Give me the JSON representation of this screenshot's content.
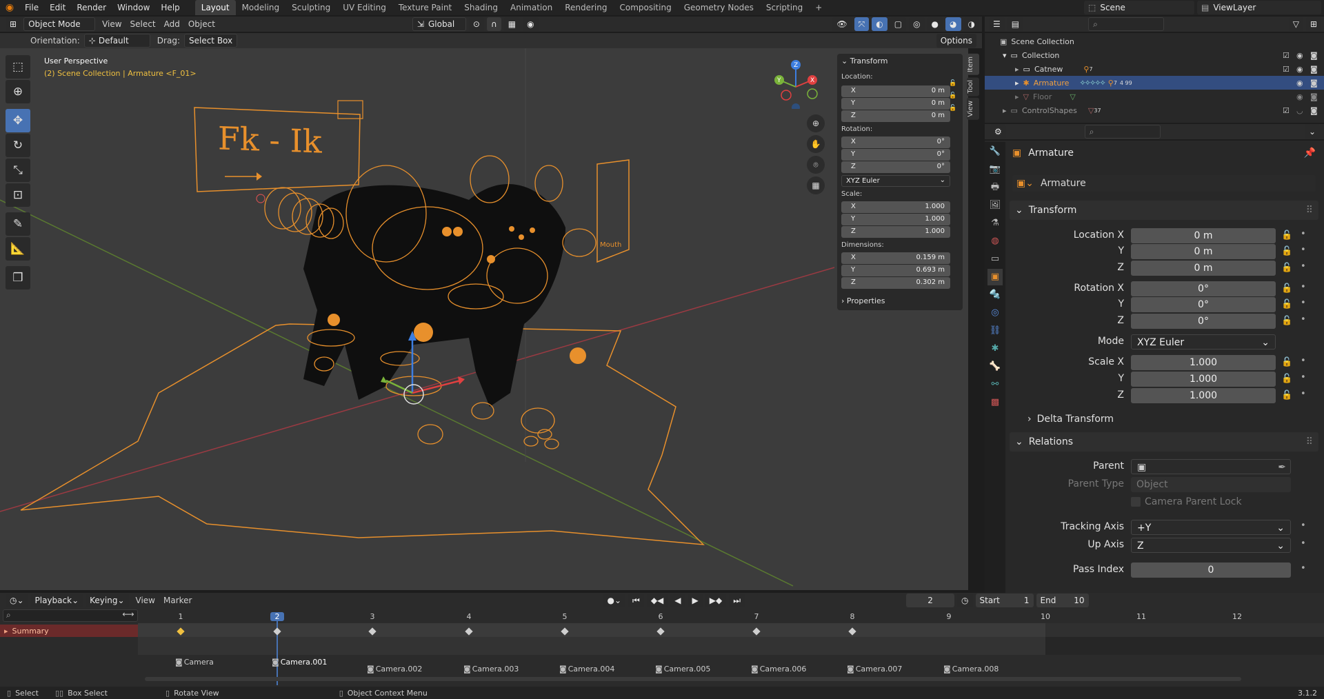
{
  "menu": {
    "items": [
      "File",
      "Edit",
      "Render",
      "Window",
      "Help"
    ]
  },
  "workspaces": [
    "Layout",
    "Modeling",
    "Sculpting",
    "UV Editing",
    "Texture Paint",
    "Shading",
    "Animation",
    "Rendering",
    "Compositing",
    "Geometry Nodes",
    "Scripting"
  ],
  "top_right": {
    "scene_label": "Scene",
    "view_layer_label": "ViewLayer",
    "plus": "+"
  },
  "viewport_header": {
    "mode": "Object Mode",
    "view": "View",
    "select": "Select",
    "add": "Add",
    "object": "Object",
    "transform_orientation": "Global",
    "orientation_label": "Orientation:",
    "orientation_value": "Default",
    "drag_label": "Drag:",
    "drag_value": "Select Box",
    "options": "Options"
  },
  "viewport": {
    "perspective": "User Perspective",
    "collection_path": "(2) Scene Collection | Armature <F_01>",
    "sign_text": "Fk  -  Ik",
    "mouth_label": "Mouth",
    "gizmo": {
      "x": "X",
      "y": "Y",
      "z": "Z"
    }
  },
  "npanel": {
    "title": "Transform",
    "location_label": "Location:",
    "location": [
      {
        "axis": "X",
        "value": "0 m"
      },
      {
        "axis": "Y",
        "value": "0 m"
      },
      {
        "axis": "Z",
        "value": "0 m"
      }
    ],
    "rotation_label": "Rotation:",
    "rotation": [
      {
        "axis": "X",
        "value": "0°"
      },
      {
        "axis": "Y",
        "value": "0°"
      },
      {
        "axis": "Z",
        "value": "0°"
      }
    ],
    "rotation_mode": "XYZ Euler",
    "scale_label": "Scale:",
    "scale": [
      {
        "axis": "X",
        "value": "1.000"
      },
      {
        "axis": "Y",
        "value": "1.000"
      },
      {
        "axis": "Z",
        "value": "1.000"
      }
    ],
    "dimensions_label": "Dimensions:",
    "dimensions": [
      {
        "axis": "X",
        "value": "0.159 m"
      },
      {
        "axis": "Y",
        "value": "0.693 m"
      },
      {
        "axis": "Z",
        "value": "0.302 m"
      }
    ],
    "properties": "Properties",
    "tabs": [
      "Item",
      "Tool",
      "View"
    ]
  },
  "outliner": {
    "root": "Scene Collection",
    "rows": [
      {
        "label": "Collection"
      },
      {
        "label": "Catnew",
        "badge": "7"
      },
      {
        "label": "Armature",
        "badge": "7",
        "badge2": "4 99"
      },
      {
        "label": "Floor"
      },
      {
        "label": "ControlShapes",
        "badge": "37"
      }
    ]
  },
  "properties": {
    "object_name": "Armature",
    "datablock_name": "Armature",
    "transform_title": "Transform",
    "location_x_label": "Location X",
    "location_x": "0 m",
    "location_y_label": "Y",
    "location_y": "0 m",
    "location_z_label": "Z",
    "location_z": "0 m",
    "rotation_x_label": "Rotation X",
    "rotation_x": "0°",
    "rotation_y_label": "Y",
    "rotation_y": "0°",
    "rotation_z_label": "Z",
    "rotation_z": "0°",
    "mode_label": "Mode",
    "mode_value": "XYZ Euler",
    "scale_x_label": "Scale X",
    "scale_x": "1.000",
    "scale_y_label": "Y",
    "scale_y": "1.000",
    "scale_z_label": "Z",
    "scale_z": "1.000",
    "delta_transform": "Delta Transform",
    "relations_title": "Relations",
    "parent_label": "Parent",
    "parent_type_label": "Parent Type",
    "parent_type_value": "Object",
    "camera_parent_lock": "Camera Parent Lock",
    "tracking_axis_label": "Tracking Axis",
    "tracking_axis_value": "+Y",
    "up_axis_label": "Up Axis",
    "up_axis_value": "Z",
    "pass_index_label": "Pass Index",
    "pass_index_value": "0"
  },
  "timeline": {
    "playback": "Playback",
    "keying": "Keying",
    "view": "View",
    "marker": "Marker",
    "current_frame": "2",
    "start_label": "Start",
    "start": "1",
    "end_label": "End",
    "end": "10",
    "summary": "Summary",
    "frames": [
      "1",
      "2",
      "3",
      "4",
      "5",
      "6",
      "7",
      "8",
      "9",
      "10",
      "11",
      "12"
    ],
    "cameras": [
      "Camera",
      "Camera.001",
      "Camera.002",
      "Camera.003",
      "Camera.004",
      "Camera.005",
      "Camera.006",
      "Camera.007",
      "Camera.008"
    ]
  },
  "statusbar": {
    "select": "Select",
    "box_select": "Box Select",
    "rotate_view": "Rotate View",
    "object_context_menu": "Object Context Menu",
    "version": "3.1.2"
  }
}
